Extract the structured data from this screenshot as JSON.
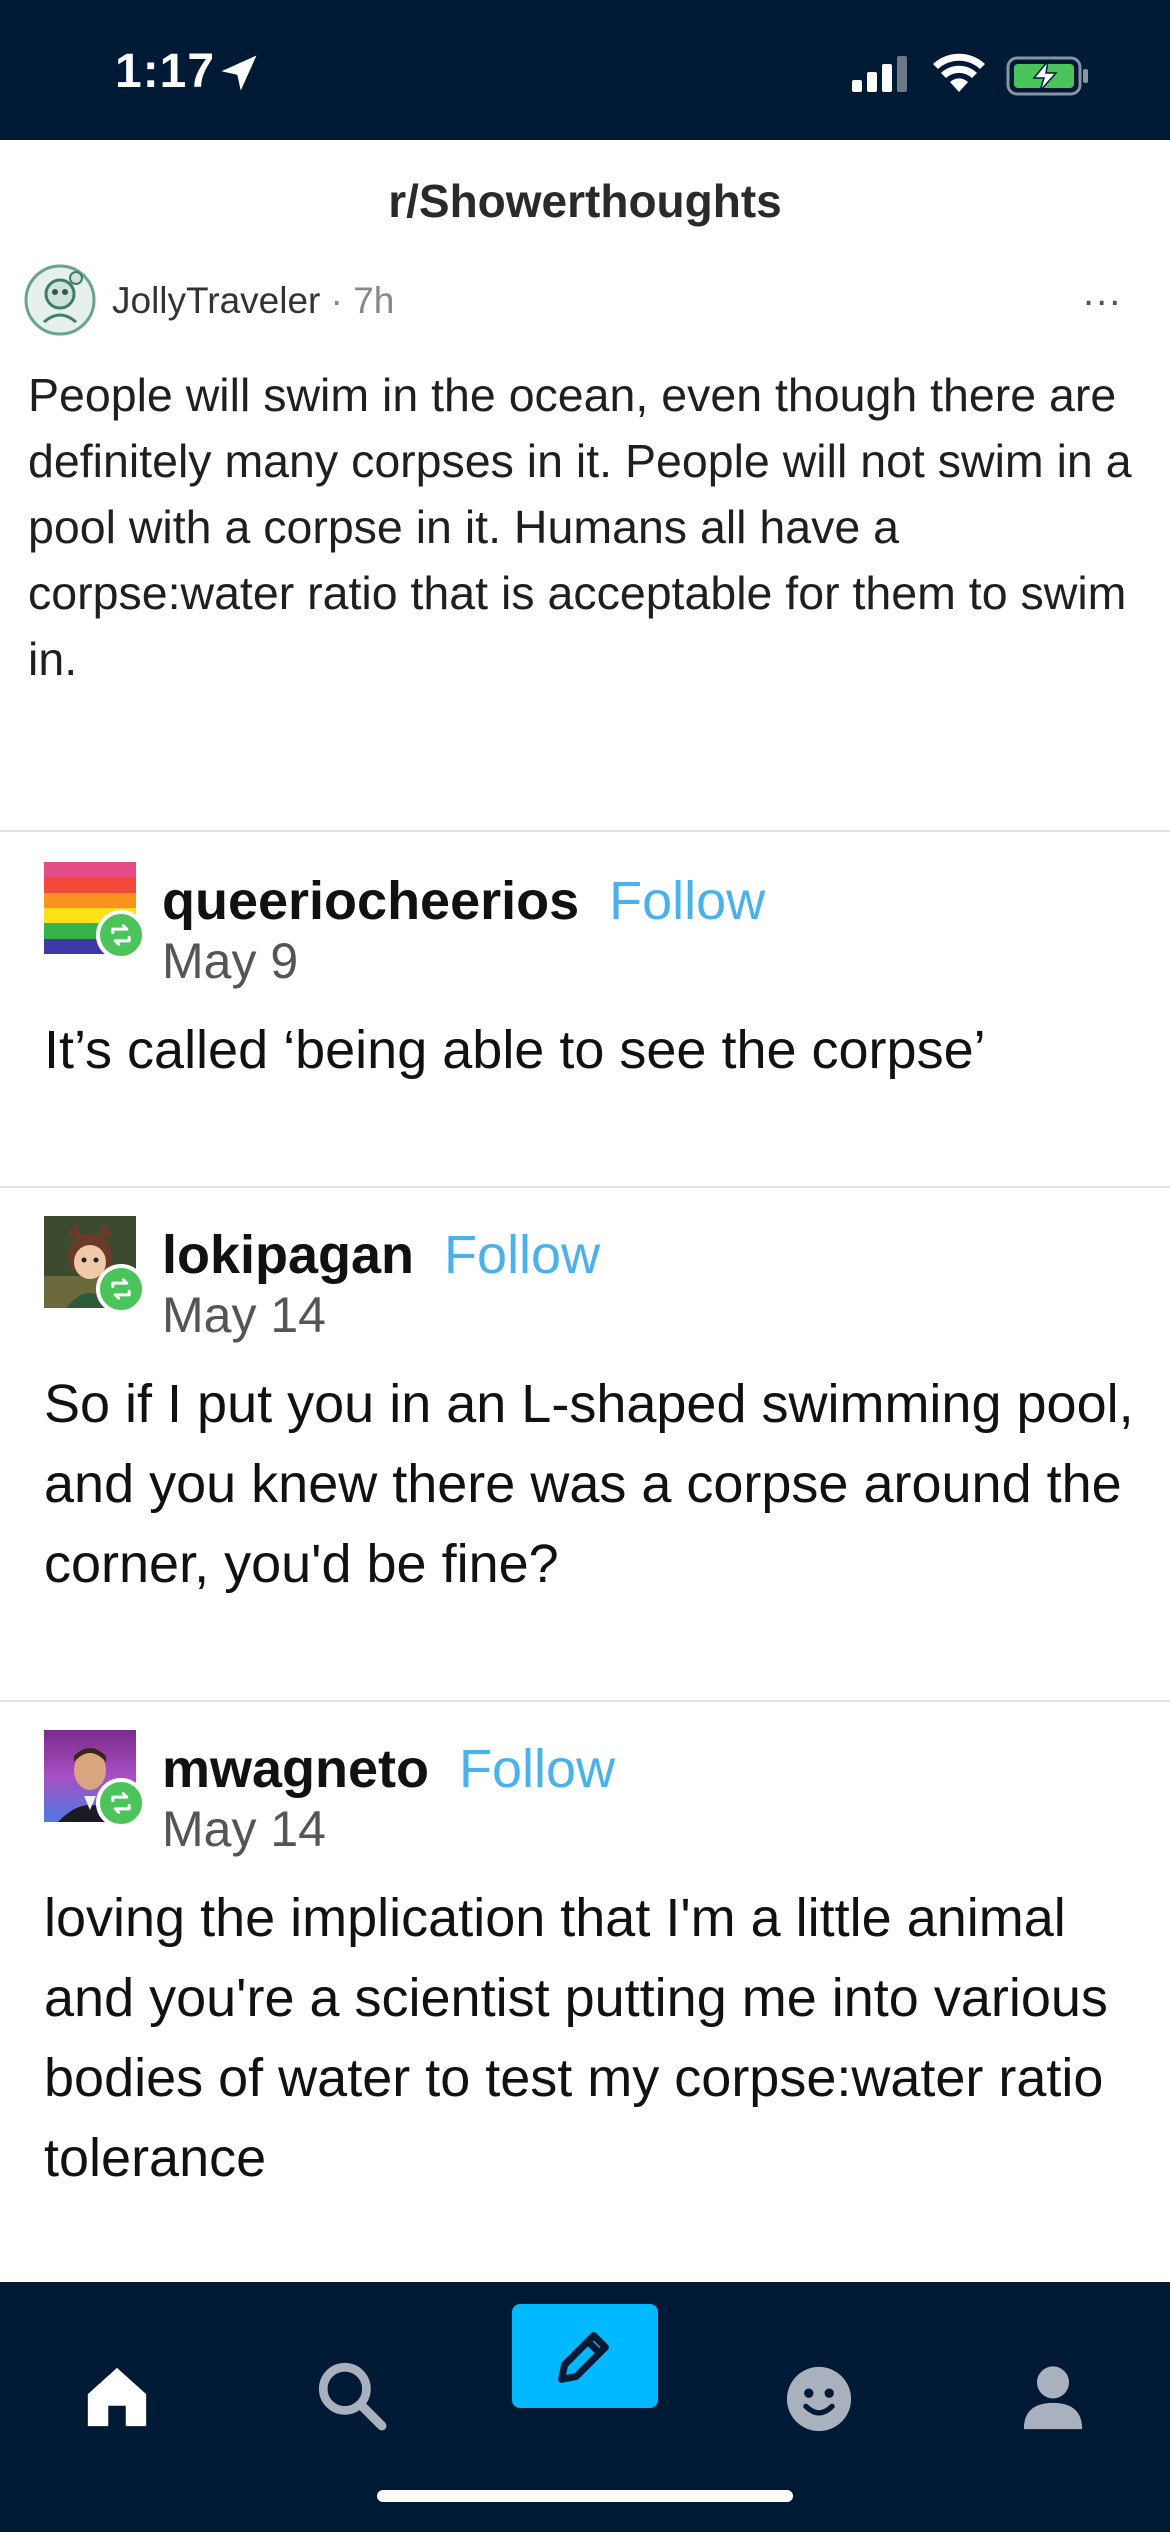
{
  "status_bar": {
    "time": "1:17",
    "icons": [
      "location-arrow-icon",
      "signal-icon",
      "wifi-icon",
      "battery-charging-icon"
    ]
  },
  "op_post": {
    "subreddit": "r/Showerthoughts",
    "username": "JollyTraveler",
    "separator": "·",
    "time": "7h",
    "more_label": "...",
    "text": "People will swim in the ocean, even though there are definitely many corpses in it. People will not swim in a pool with a corpse in it. Humans all have a corpse:water ratio that is acceptable for them to swim in."
  },
  "replies": [
    {
      "username": "queeriocheerios",
      "follow_label": "Follow",
      "date": "May 9",
      "text": "It’s called ‘being able to see the corpse’"
    },
    {
      "username": "lokipagan",
      "follow_label": "Follow",
      "date": "May 14",
      "text": "So if I put you in an L-shaped swimming pool, and  you knew there was a corpse around the corner, you'd be fine?"
    },
    {
      "username": "mwagneto",
      "follow_label": "Follow",
      "date": "May 14",
      "text": "loving the implication that I'm a little animal and you're a scientist putting me into various bodies of water to test my corpse:water ratio tolerance"
    }
  ],
  "tab_bar": {
    "tabs": [
      "home-icon",
      "search-icon",
      "compose-icon",
      "activity-icon",
      "account-icon"
    ],
    "accent": "#00b8ff",
    "background": "#001935"
  },
  "colors": {
    "follow": "#4bb1ea",
    "reblog_badge": "#4ac45b"
  }
}
